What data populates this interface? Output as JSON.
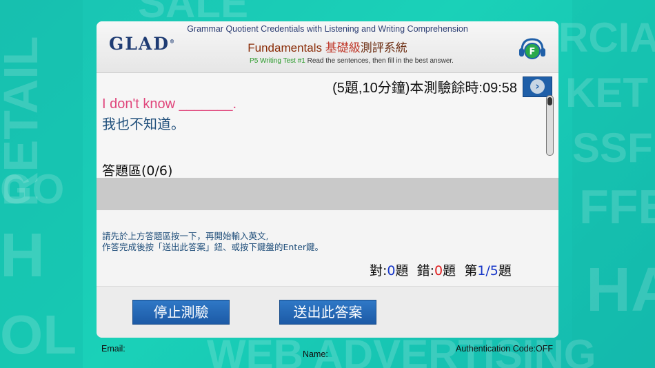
{
  "header": {
    "logo": "GLAD",
    "subtitle": "Grammar Quotient Credentials with Listening and Writing Comprehension",
    "title_en": "Fundamentals ",
    "title_zh1": "基礎級",
    "title_zh2": "測評系統",
    "desc_tag": "P5 Writing Test #1",
    "desc": " Read the sentences, then fill in the best answer.",
    "badge_letter": "F"
  },
  "question": {
    "timer": "(5題,10分鐘)本測驗餘時:09:58",
    "next_icon": "chevron-right-icon",
    "text": "I don't know _______.",
    "translation": "我也不知道。"
  },
  "answer": {
    "label": "答題區(0/6)",
    "value": ""
  },
  "instructions": {
    "line1": "請先於上方答題區按一下，再開始輸入英文,",
    "line2": "作答完成後按「送出此答案」鈕、或按下鍵盤的Enter鍵。"
  },
  "score": {
    "correct_label": "對:",
    "correct": "0",
    "correct_unit": "題",
    "wrong_label": "錯:",
    "wrong": "0",
    "wrong_unit": "題",
    "progress_prefix": "第",
    "progress": "1/5",
    "progress_suffix": "題"
  },
  "buttons": {
    "stop": "停止測驗",
    "submit": "送出此答案"
  },
  "footer": {
    "email": "Email:",
    "name": "Name:",
    "auth": "Authentication Code:OFF"
  },
  "colors": {
    "background": "#19c3b3",
    "title": "#8a2c07",
    "question": "#e0457b",
    "button": "#1c5aa6"
  }
}
